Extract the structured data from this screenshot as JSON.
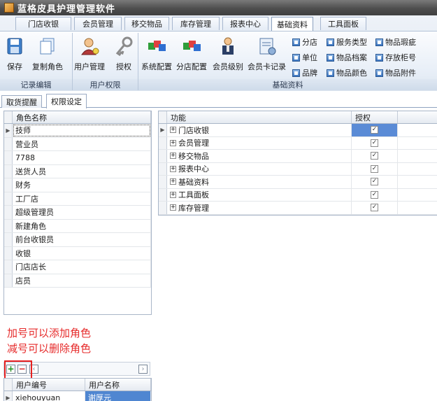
{
  "window": {
    "title": "蓝格皮具护理管理软件"
  },
  "ribbon": {
    "tabs": [
      "门店收银",
      "会员管理",
      "移交物品",
      "库存管理",
      "报表中心",
      "基础资料",
      "工具面板"
    ],
    "active_tab": "基础资料",
    "groups": {
      "record": {
        "label": "记录编辑",
        "buttons": [
          "保存",
          "复制角色"
        ]
      },
      "permission": {
        "label": "用户权限",
        "buttons": [
          "用户管理",
          "授权"
        ]
      },
      "basic": {
        "label": "基础资料",
        "buttons": [
          "系统配置",
          "分店配置",
          "会员级别",
          "会员卡记录"
        ],
        "small_buttons": [
          [
            "分店",
            "服务类型",
            "物品瑕疵"
          ],
          [
            "单位",
            "物品档案",
            "存放柜号"
          ],
          [
            "品牌",
            "物品颜色",
            "物品附件"
          ]
        ]
      }
    }
  },
  "doc_tabs": [
    "取货提醒",
    "权限设定"
  ],
  "roles": {
    "header": "角色名称",
    "items": [
      "技师",
      "营业员",
      "7788",
      "送货人员",
      "财务",
      "工厂店",
      "超级管理员",
      "新建角色",
      "前台收银员",
      "收银",
      "门店店长",
      "店员"
    ],
    "selected": "技师"
  },
  "functions": {
    "headers": {
      "name": "功能",
      "auth": "授权"
    },
    "items": [
      {
        "name": "门店收银",
        "auth": true
      },
      {
        "name": "会员管理",
        "auth": true
      },
      {
        "name": "移交物品",
        "auth": true
      },
      {
        "name": "报表中心",
        "auth": true
      },
      {
        "name": "基础资料",
        "auth": true
      },
      {
        "name": "工具面板",
        "auth": true
      },
      {
        "name": "库存管理",
        "auth": true
      }
    ]
  },
  "annotation": {
    "line1": "加号可以添加角色",
    "line2": "减号可以删除角色"
  },
  "users": {
    "headers": {
      "code": "用户编号",
      "name": "用户名称"
    },
    "rows": [
      {
        "code": "xiehouyuan",
        "name": "谢厚元"
      }
    ]
  },
  "colors": {
    "annotation": "#e62b2b",
    "selection": "#5a8bd6",
    "titlebar": "#4e4e4e"
  }
}
